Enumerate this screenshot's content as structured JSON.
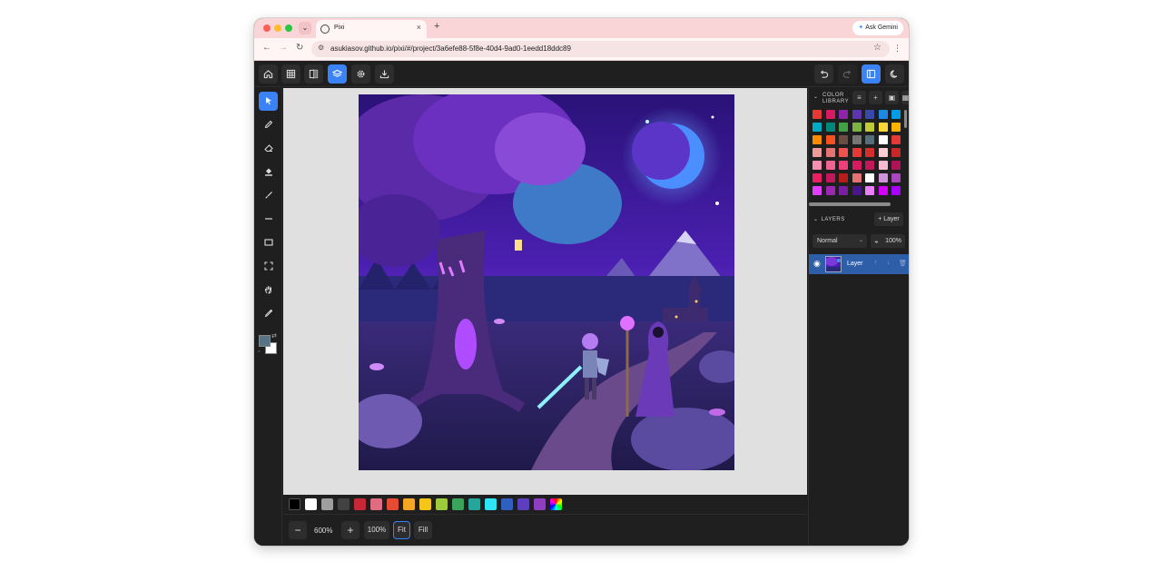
{
  "browser": {
    "tab_title": "Pixi",
    "new_tab": "+",
    "tab_close": "×",
    "dropdown": "⌄",
    "url": "asukiasov.github.io/pixi/#/project/3a6efe88-5f8e-40d4-9ad0-1eedd18ddc89",
    "ask_gemini": "Ask Gemini"
  },
  "topbar": {
    "left_buttons": [
      "home-icon",
      "grid-icon",
      "compare-icon",
      "layers-icon",
      "settings-icon",
      "download-icon"
    ],
    "active_button": "layers-icon",
    "right_buttons": [
      "undo-icon",
      "redo-icon",
      "panel-icon",
      "moon-icon"
    ],
    "active_right": "panel-icon"
  },
  "tools": [
    "select-icon",
    "pencil-icon",
    "eraser-icon",
    "fill-icon",
    "brush-icon",
    "line-icon",
    "rectangle-icon",
    "marquee-icon",
    "hand-icon",
    "eyedropper-icon"
  ],
  "active_tool": "select-icon",
  "colors": {
    "foreground": "#587383",
    "background": "#ffffff",
    "accent": "#3b82f6"
  },
  "palette": [
    "#000000",
    "#ffffff",
    "#9e9e9e",
    "#424242",
    "#c62838",
    "#e06c82",
    "#e64a33",
    "#f5a623",
    "#f5c518",
    "#9ccc3c",
    "#3aa55a",
    "#26a69a",
    "#2ee5f5",
    "#2f5fbf",
    "#5b3fbf",
    "#8e3fbf"
  ],
  "zoom": {
    "minus": "−",
    "level": "600%",
    "plus": "+",
    "reset": "100%",
    "fit": "Fit",
    "fill": "Fill"
  },
  "color_library": {
    "title_line1": "COLOR",
    "title_line2": "LIBRARY",
    "swatches": [
      [
        "#e53935",
        "#d81b60",
        "#8e24aa",
        "#5e35b1",
        "#3949ab",
        "#1e88e5",
        "#039be5"
      ],
      [
        "#00acc1",
        "#00897b",
        "#43a047",
        "#7cb342",
        "#c0ca33",
        "#fdd835",
        "#ffb300"
      ],
      [
        "#fb8c00",
        "#f4511e",
        "#6d4c41",
        "#757575",
        "#546e7a",
        "#ffffff",
        "#e53935"
      ],
      [
        "#ef9a9a",
        "#e57373",
        "#ef5350",
        "#e53935",
        "#d32f2f",
        "#ffcdd2",
        "#c62828"
      ],
      [
        "#f48fb1",
        "#f06292",
        "#ec407a",
        "#d81b60",
        "#c2185b",
        "#f8bbd0",
        "#ad1457"
      ],
      [
        "#e91e63",
        "#c2185b",
        "#b71c1c",
        "#e57373",
        "#ffffff",
        "#ce93d8",
        "#ab47bc"
      ],
      [
        "#e040fb",
        "#9c27b0",
        "#7b1fa2",
        "#4a148c",
        "#ea80fc",
        "#d500f9",
        "#aa00ff"
      ]
    ]
  },
  "layers": {
    "title": "LAYERS",
    "add_button": "+ Layer",
    "blend_mode": "Normal",
    "opacity": "100%",
    "items": [
      {
        "name": "Layer"
      }
    ]
  }
}
